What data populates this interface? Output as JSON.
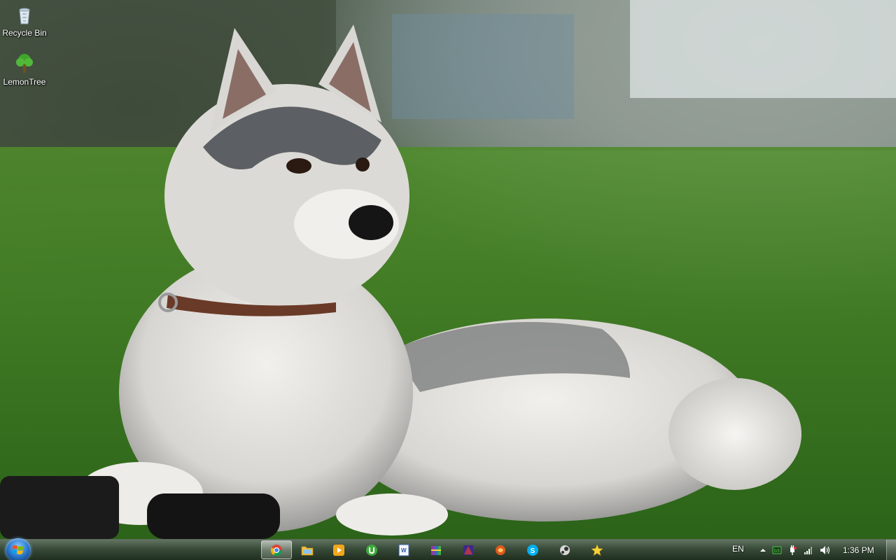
{
  "desktop": {
    "wallpaper_description_icon": "husky-wallpaper",
    "icons": [
      {
        "label": "Recycle Bin",
        "icon": "recycle-bin-icon"
      },
      {
        "label": "LemonTree",
        "icon": "tree-icon"
      }
    ]
  },
  "taskbar": {
    "start_icon": "windows-logo-icon",
    "pinned": [
      {
        "name": "chrome",
        "icon": "chrome-icon",
        "active": true
      },
      {
        "name": "explorer",
        "icon": "folder-icon",
        "active": false
      },
      {
        "name": "media-player",
        "icon": "media-player-icon",
        "active": false
      },
      {
        "name": "utorrent",
        "icon": "utorrent-icon",
        "active": false
      },
      {
        "name": "word",
        "icon": "word-icon",
        "active": false
      },
      {
        "name": "winrar",
        "icon": "archive-icon",
        "active": false
      },
      {
        "name": "app-purple",
        "icon": "app-icon",
        "active": false
      },
      {
        "name": "app-orange",
        "icon": "app-icon",
        "active": false
      },
      {
        "name": "skype",
        "icon": "skype-icon",
        "active": false
      },
      {
        "name": "app-steam",
        "icon": "app-icon",
        "active": false
      },
      {
        "name": "app-star",
        "icon": "star-icon",
        "active": false
      }
    ],
    "tray": {
      "language": "EN",
      "clock": "1:36 PM"
    }
  },
  "colors": {
    "taskbar_bg": "#233a23",
    "start_orb": "#2d7fd4",
    "text": "#ffffff"
  }
}
